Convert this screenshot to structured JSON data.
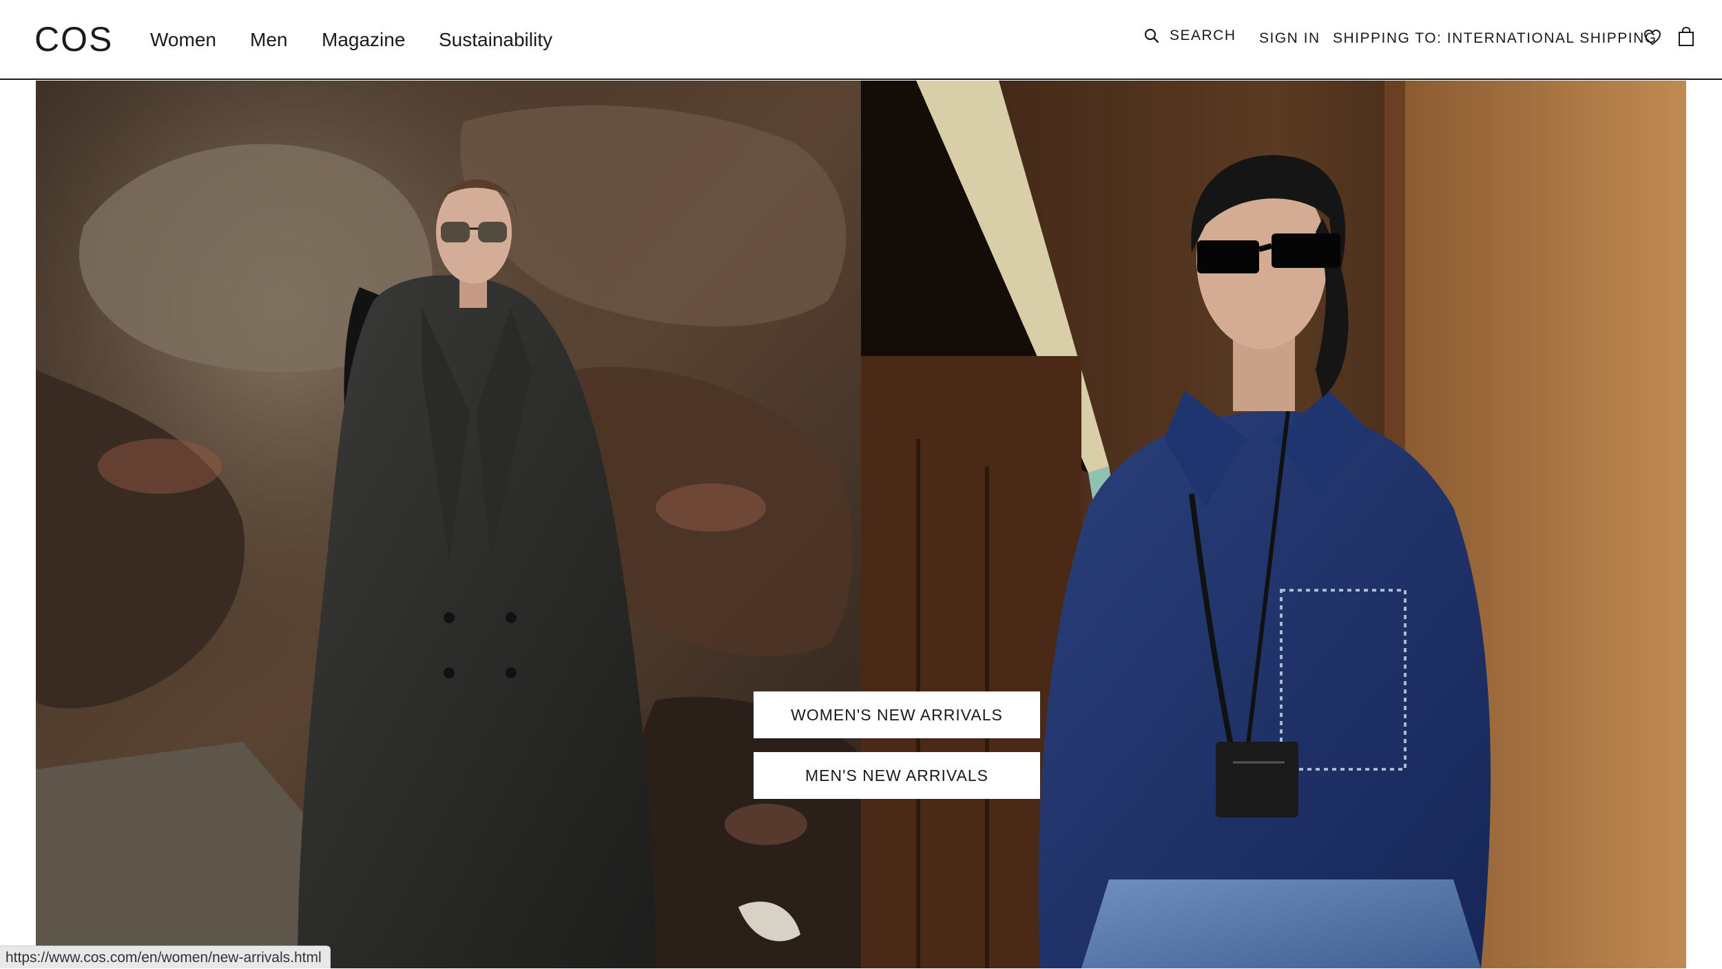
{
  "header": {
    "logo": "COS",
    "nav": [
      {
        "label": "Women"
      },
      {
        "label": "Men"
      },
      {
        "label": "Magazine"
      },
      {
        "label": "Sustainability"
      }
    ],
    "search_label": "SEARCH",
    "signin_label": "SIGN IN",
    "shipping_label": "SHIPPING TO: INTERNATIONAL SHIPPING",
    "icons": [
      "search-icon",
      "heart-icon",
      "shopping-bag-icon"
    ]
  },
  "hero": {
    "left_image": "woman in long dark trench coat and sunglasses against volcanic rock",
    "right_image": "man in denim shirt and dark sunglasses with lanyard card holder in corridor",
    "cta": [
      {
        "label": "WOMEN'S NEW ARRIVALS"
      },
      {
        "label": "MEN'S NEW ARRIVALS"
      }
    ]
  },
  "status_bar": {
    "url": "https://www.cos.com/en/women/new-arrivals.html"
  },
  "colors": {
    "text": "#1a1a1a",
    "background": "#ffffff",
    "denim": "#1f3570",
    "rock": "#4a3a2e",
    "wall": "#b07a42"
  }
}
